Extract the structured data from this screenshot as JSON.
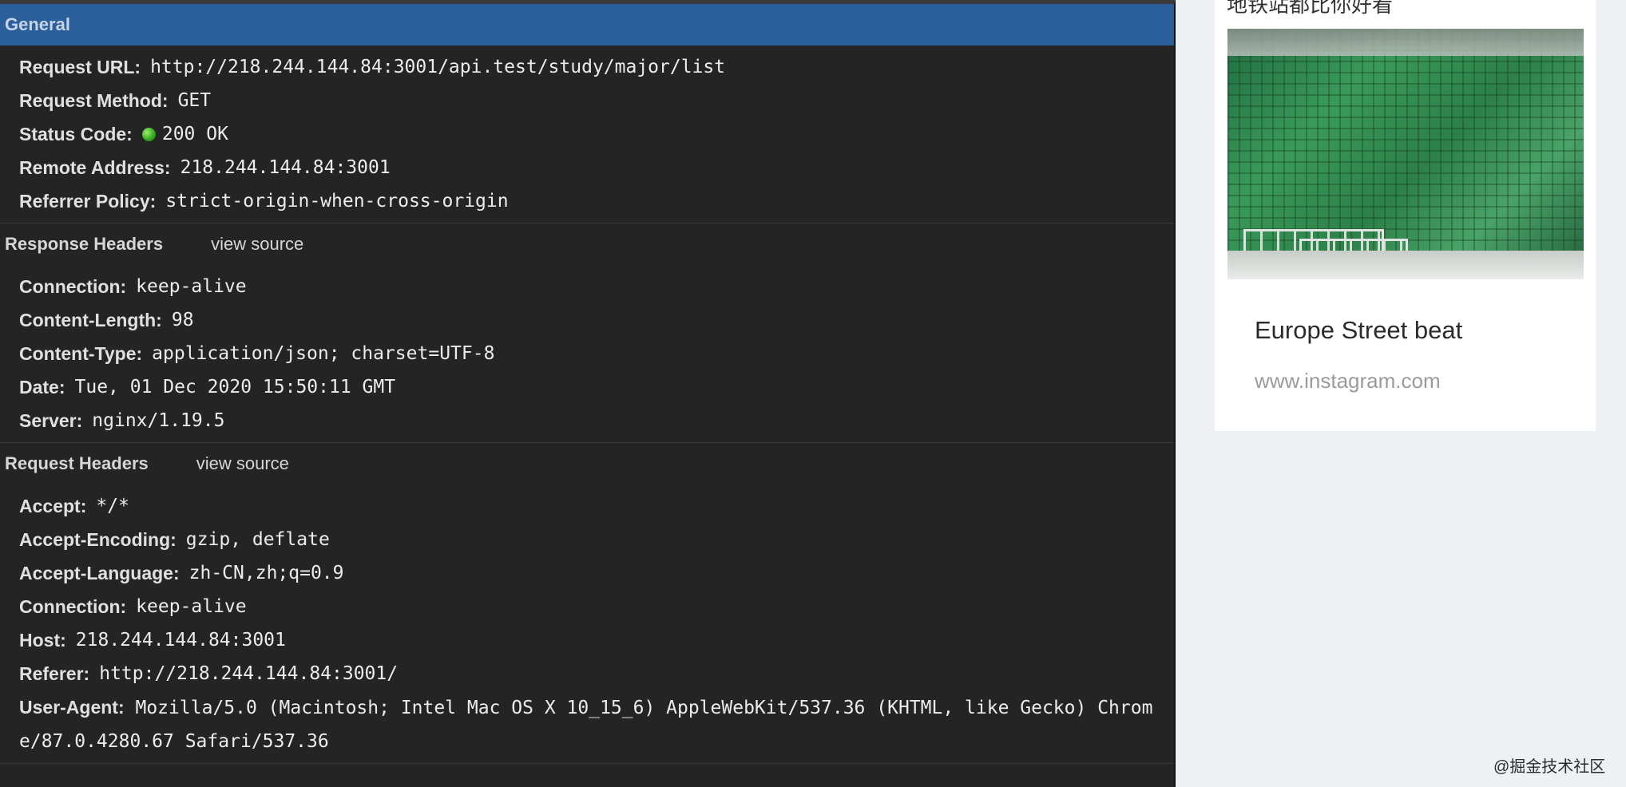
{
  "general": {
    "title": "General",
    "rows": [
      {
        "key": "Request URL:",
        "value": "http://218.244.144.84:3001/api.test/study/major/list"
      },
      {
        "key": "Request Method:",
        "value": "GET"
      },
      {
        "key": "Status Code:",
        "value": "200 OK"
      },
      {
        "key": "Remote Address:",
        "value": "218.244.144.84:3001"
      },
      {
        "key": "Referrer Policy:",
        "value": "strict-origin-when-cross-origin"
      }
    ],
    "status_color": "#3fb02a"
  },
  "response_headers": {
    "title": "Response Headers",
    "view_source": "view source",
    "rows": [
      {
        "key": "Connection:",
        "value": "keep-alive"
      },
      {
        "key": "Content-Length:",
        "value": "98"
      },
      {
        "key": "Content-Type:",
        "value": "application/json; charset=UTF-8"
      },
      {
        "key": "Date:",
        "value": "Tue, 01 Dec 2020 15:50:11 GMT"
      },
      {
        "key": "Server:",
        "value": "nginx/1.19.5"
      }
    ]
  },
  "request_headers": {
    "title": "Request Headers",
    "view_source": "view source",
    "rows": [
      {
        "key": "Accept:",
        "value": "*/*"
      },
      {
        "key": "Accept-Encoding:",
        "value": "gzip, deflate"
      },
      {
        "key": "Accept-Language:",
        "value": "zh-CN,zh;q=0.9"
      },
      {
        "key": "Connection:",
        "value": "keep-alive"
      },
      {
        "key": "Host:",
        "value": "218.244.144.84:3001"
      },
      {
        "key": "Referer:",
        "value": "http://218.244.144.84:3001/"
      },
      {
        "key": "User-Agent:",
        "value": "Mozilla/5.0 (Macintosh; Intel Mac OS X 10_15_6) AppleWebKit/537.36 (KHTML, like Gecko) Chrome/87.0.4280.67 Safari/537.36"
      }
    ]
  },
  "card": {
    "cut_title": "地铁站都比你好看",
    "title": "Europe Street beat",
    "subtitle": "www.instagram.com"
  },
  "watermark": "@掘金技术社区",
  "colors": {
    "panel_bg": "#242424",
    "header_blue": "#2a5f9b",
    "page_bg": "#eef1f4"
  }
}
